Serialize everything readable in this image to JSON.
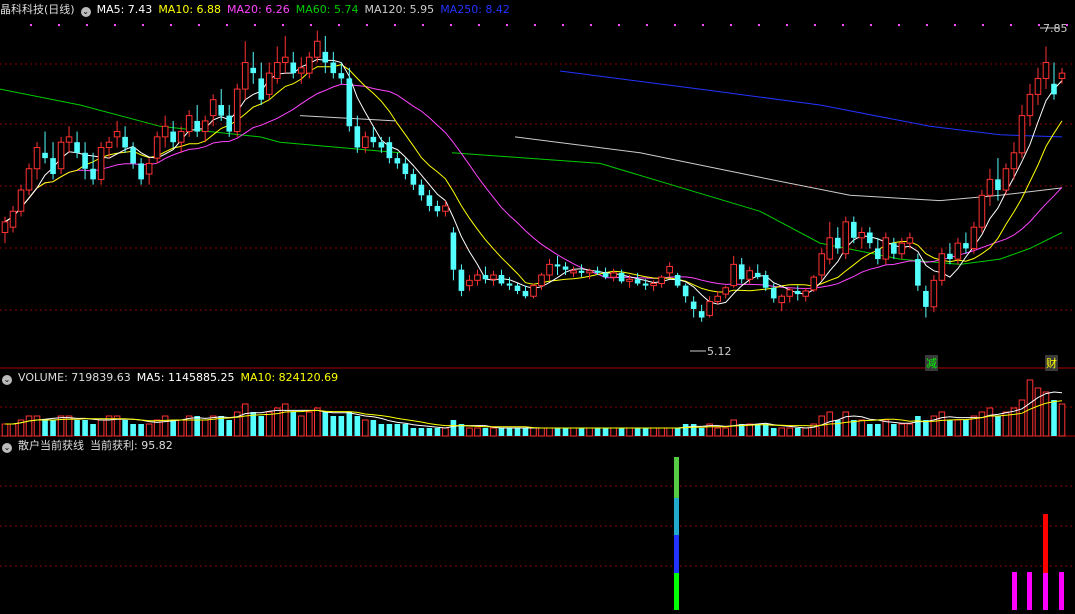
{
  "colors": {
    "up": "#ff3232",
    "down": "#54ffff",
    "ma5": "#ffffff",
    "ma10": "#ffff00",
    "ma20": "#ff44ff",
    "ma60": "#00cc00",
    "ma120": "#cccccc",
    "ma250": "#2233ff",
    "grid": "#8b0000",
    "divider": "#aa0000"
  },
  "header": {
    "stock": "晶科科技(日线)",
    "ma5": "MA5: 7.43",
    "ma10": "MA10: 6.88",
    "ma20": "MA20: 6.26",
    "ma60": "MA60: 5.74",
    "ma120": "MA120: 5.95",
    "ma250": "MA250: 8.42"
  },
  "volume_header": {
    "volume": "VOLUME: 719839.63",
    "ma5": "MA5: 1145885.25",
    "ma10": "MA10: 824120.69"
  },
  "indicator_header": {
    "name": "散户当前获线",
    "profit": "当前获利: 95.82"
  },
  "annotations": {
    "high": "7.85",
    "low": "5.12",
    "mark_jian": "减",
    "mark_cai": "财"
  },
  "chart_data": [
    {
      "type": "candlestick",
      "title": "晶科科技(日线)",
      "ylim": [
        4.9,
        8.1
      ],
      "ohlc": [
        [
          6.1,
          6.25,
          6.0,
          6.2
        ],
        [
          6.15,
          6.35,
          6.1,
          6.3
        ],
        [
          6.3,
          6.55,
          6.25,
          6.5
        ],
        [
          6.5,
          6.75,
          6.45,
          6.7
        ],
        [
          6.7,
          6.95,
          6.6,
          6.9
        ],
        [
          6.85,
          7.05,
          6.75,
          6.8
        ],
        [
          6.8,
          6.95,
          6.6,
          6.65
        ],
        [
          6.7,
          7.0,
          6.65,
          6.95
        ],
        [
          6.95,
          7.1,
          6.85,
          7.0
        ],
        [
          6.95,
          7.05,
          6.8,
          6.85
        ],
        [
          6.85,
          6.95,
          6.6,
          6.7
        ],
        [
          6.7,
          6.85,
          6.55,
          6.6
        ],
        [
          6.6,
          6.95,
          6.55,
          6.9
        ],
        [
          6.9,
          7.0,
          6.8,
          6.95
        ],
        [
          7.0,
          7.15,
          6.9,
          7.05
        ],
        [
          7.0,
          7.1,
          6.85,
          6.9
        ],
        [
          6.9,
          6.95,
          6.7,
          6.75
        ],
        [
          6.75,
          6.8,
          6.55,
          6.6
        ],
        [
          6.65,
          6.8,
          6.55,
          6.75
        ],
        [
          6.8,
          7.05,
          6.75,
          7.0
        ],
        [
          7.0,
          7.2,
          6.9,
          7.1
        ],
        [
          7.05,
          7.15,
          6.9,
          6.95
        ],
        [
          6.95,
          7.1,
          6.85,
          7.05
        ],
        [
          7.05,
          7.25,
          7.0,
          7.2
        ],
        [
          7.15,
          7.3,
          7.0,
          7.05
        ],
        [
          7.05,
          7.2,
          6.95,
          7.15
        ],
        [
          7.2,
          7.4,
          7.1,
          7.35
        ],
        [
          7.3,
          7.45,
          7.15,
          7.2
        ],
        [
          7.2,
          7.3,
          7.0,
          7.05
        ],
        [
          7.05,
          7.5,
          7.0,
          7.45
        ],
        [
          7.45,
          7.9,
          7.35,
          7.7
        ],
        [
          7.65,
          7.8,
          7.5,
          7.6
        ],
        [
          7.55,
          7.7,
          7.3,
          7.35
        ],
        [
          7.4,
          7.7,
          7.35,
          7.6
        ],
        [
          7.55,
          7.85,
          7.5,
          7.7
        ],
        [
          7.7,
          7.95,
          7.6,
          7.75
        ],
        [
          7.7,
          7.8,
          7.55,
          7.6
        ],
        [
          7.6,
          7.75,
          7.5,
          7.65
        ],
        [
          7.6,
          7.8,
          7.55,
          7.75
        ],
        [
          7.75,
          8.0,
          7.7,
          7.9
        ],
        [
          7.8,
          7.95,
          7.6,
          7.7
        ],
        [
          7.7,
          7.8,
          7.55,
          7.6
        ],
        [
          7.6,
          7.7,
          7.5,
          7.55
        ],
        [
          7.55,
          7.65,
          7.05,
          7.1
        ],
        [
          7.1,
          7.2,
          6.85,
          6.9
        ],
        [
          6.9,
          7.05,
          6.85,
          7.0
        ],
        [
          7.0,
          7.1,
          6.9,
          6.95
        ],
        [
          6.95,
          7.0,
          6.85,
          6.9
        ],
        [
          6.95,
          7.0,
          6.75,
          6.8
        ],
        [
          6.8,
          6.85,
          6.7,
          6.75
        ],
        [
          6.75,
          6.8,
          6.6,
          6.65
        ],
        [
          6.65,
          6.7,
          6.5,
          6.55
        ],
        [
          6.55,
          6.6,
          6.4,
          6.45
        ],
        [
          6.45,
          6.5,
          6.3,
          6.35
        ],
        [
          6.35,
          6.4,
          6.25,
          6.3
        ],
        [
          6.3,
          6.4,
          6.25,
          6.35
        ],
        [
          6.1,
          6.15,
          5.65,
          5.75
        ],
        [
          5.75,
          5.8,
          5.5,
          5.55
        ],
        [
          5.6,
          5.7,
          5.55,
          5.65
        ],
        [
          5.65,
          5.75,
          5.6,
          5.7
        ],
        [
          5.7,
          5.78,
          5.62,
          5.66
        ],
        [
          5.66,
          5.74,
          5.6,
          5.7
        ],
        [
          5.7,
          5.75,
          5.6,
          5.62
        ],
        [
          5.62,
          5.68,
          5.56,
          5.6
        ],
        [
          5.6,
          5.62,
          5.52,
          5.55
        ],
        [
          5.55,
          5.6,
          5.48,
          5.5
        ],
        [
          5.5,
          5.62,
          5.48,
          5.6
        ],
        [
          5.6,
          5.72,
          5.56,
          5.7
        ],
        [
          5.7,
          5.85,
          5.65,
          5.8
        ],
        [
          5.8,
          5.88,
          5.7,
          5.78
        ],
        [
          5.78,
          5.82,
          5.7,
          5.75
        ],
        [
          5.72,
          5.78,
          5.68,
          5.74
        ],
        [
          5.74,
          5.8,
          5.68,
          5.72
        ],
        [
          5.72,
          5.76,
          5.66,
          5.74
        ],
        [
          5.74,
          5.78,
          5.7,
          5.72
        ],
        [
          5.72,
          5.77,
          5.66,
          5.68
        ],
        [
          5.68,
          5.76,
          5.64,
          5.72
        ],
        [
          5.72,
          5.75,
          5.62,
          5.64
        ],
        [
          5.64,
          5.7,
          5.58,
          5.66
        ],
        [
          5.66,
          5.72,
          5.6,
          5.62
        ],
        [
          5.62,
          5.66,
          5.56,
          5.6
        ],
        [
          5.6,
          5.65,
          5.55,
          5.62
        ],
        [
          5.62,
          5.7,
          5.58,
          5.68
        ],
        [
          5.72,
          5.82,
          5.68,
          5.78
        ],
        [
          5.7,
          5.72,
          5.58,
          5.6
        ],
        [
          5.6,
          5.62,
          5.44,
          5.5
        ],
        [
          5.45,
          5.5,
          5.3,
          5.38
        ],
        [
          5.36,
          5.42,
          5.26,
          5.3
        ],
        [
          5.32,
          5.5,
          5.3,
          5.45
        ],
        [
          5.45,
          5.55,
          5.42,
          5.5
        ],
        [
          5.52,
          5.6,
          5.48,
          5.58
        ],
        [
          5.6,
          5.88,
          5.58,
          5.8
        ],
        [
          5.8,
          5.86,
          5.62,
          5.66
        ],
        [
          5.66,
          5.78,
          5.62,
          5.74
        ],
        [
          5.72,
          5.8,
          5.66,
          5.68
        ],
        [
          5.7,
          5.74,
          5.55,
          5.58
        ],
        [
          5.58,
          5.62,
          5.44,
          5.48
        ],
        [
          5.44,
          5.52,
          5.36,
          5.5
        ],
        [
          5.5,
          5.58,
          5.44,
          5.56
        ],
        [
          5.55,
          5.6,
          5.46,
          5.52
        ],
        [
          5.5,
          5.58,
          5.45,
          5.55
        ],
        [
          5.56,
          5.7,
          5.54,
          5.68
        ],
        [
          5.7,
          5.95,
          5.65,
          5.9
        ],
        [
          5.85,
          6.2,
          5.8,
          6.05
        ],
        [
          6.05,
          6.15,
          5.9,
          5.95
        ],
        [
          5.9,
          6.25,
          5.85,
          6.2
        ],
        [
          6.2,
          6.25,
          6.0,
          6.05
        ],
        [
          6.05,
          6.15,
          5.95,
          6.1
        ],
        [
          6.1,
          6.15,
          5.95,
          6.0
        ],
        [
          5.95,
          6.05,
          5.8,
          5.85
        ],
        [
          5.85,
          6.1,
          5.8,
          6.05
        ],
        [
          6.0,
          6.05,
          5.85,
          5.9
        ],
        [
          5.9,
          6.05,
          5.85,
          6.0
        ],
        [
          6.0,
          6.1,
          5.95,
          6.05
        ],
        [
          5.85,
          5.9,
          5.55,
          5.6
        ],
        [
          5.55,
          5.6,
          5.3,
          5.4
        ],
        [
          5.4,
          5.7,
          5.35,
          5.65
        ],
        [
          5.65,
          5.95,
          5.6,
          5.9
        ],
        [
          5.9,
          6.0,
          5.8,
          5.85
        ],
        [
          5.85,
          6.05,
          5.8,
          6.0
        ],
        [
          6.0,
          6.1,
          5.9,
          5.95
        ],
        [
          5.95,
          6.2,
          5.9,
          6.15
        ],
        [
          6.15,
          6.5,
          6.1,
          6.45
        ],
        [
          6.45,
          6.7,
          6.35,
          6.6
        ],
        [
          6.6,
          6.8,
          6.4,
          6.5
        ],
        [
          6.5,
          6.75,
          6.45,
          6.7
        ],
        [
          6.7,
          6.95,
          6.6,
          6.85
        ],
        [
          6.85,
          7.3,
          6.8,
          7.2
        ],
        [
          7.2,
          7.5,
          7.1,
          7.4
        ],
        [
          7.4,
          7.65,
          7.3,
          7.55
        ],
        [
          7.55,
          7.85,
          7.45,
          7.7
        ],
        [
          7.5,
          7.7,
          7.35,
          7.4
        ],
        [
          7.55,
          7.65,
          7.5,
          7.6
        ]
      ],
      "ma_series": [
        {
          "name": "MA60",
          "values": [
            [
              0,
              7.45
            ],
            [
              80,
              7.3
            ],
            [
              160,
              7.1
            ],
            [
              260,
              7.0
            ],
            [
              280,
              6.95
            ],
            [
              400,
              6.85
            ]
          ]
        },
        {
          "name": "MA120",
          "values": [
            [
              300,
              7.2
            ],
            [
              395,
              7.15
            ]
          ]
        },
        {
          "name": "MA60",
          "values": [
            [
              452,
              6.85
            ],
            [
              600,
              6.75
            ],
            [
              760,
              6.3
            ],
            [
              820,
              6.0
            ],
            [
              900,
              5.85
            ],
            [
              960,
              5.8
            ],
            [
              1000,
              5.85
            ],
            [
              1030,
              5.95
            ],
            [
              1062,
              6.1
            ]
          ]
        },
        {
          "name": "MA120",
          "values": [
            [
              515,
              7.0
            ],
            [
              640,
              6.85
            ],
            [
              760,
              6.62
            ],
            [
              850,
              6.45
            ],
            [
              940,
              6.4
            ],
            [
              1000,
              6.45
            ],
            [
              1062,
              6.52
            ]
          ]
        },
        {
          "name": "MA250",
          "values": [
            [
              560,
              7.62
            ],
            [
              700,
              7.45
            ],
            [
              820,
              7.3
            ],
            [
              930,
              7.1
            ],
            [
              1000,
              7.02
            ],
            [
              1062,
              7.0
            ]
          ]
        }
      ]
    },
    {
      "type": "bar",
      "title": "VOLUME",
      "note": "volume bars (relative values)",
      "values": [
        3,
        3,
        4,
        5,
        5,
        4,
        4,
        5,
        5,
        4,
        4,
        3,
        4,
        5,
        5,
        4,
        3,
        3,
        3,
        4,
        5,
        4,
        4,
        5,
        5,
        4,
        5,
        5,
        4,
        6,
        8,
        6,
        5,
        6,
        7,
        8,
        6,
        5,
        6,
        7,
        6,
        5,
        5,
        6,
        5,
        4,
        4,
        3,
        3,
        3,
        3,
        2,
        2,
        2,
        2,
        2,
        4,
        3,
        2,
        2,
        2,
        2,
        2,
        2,
        2,
        2,
        2,
        2,
        2,
        2,
        2,
        2,
        2,
        2,
        2,
        2,
        2,
        2,
        2,
        2,
        2,
        2,
        2,
        2,
        2,
        3,
        3,
        2,
        3,
        2,
        2,
        4,
        3,
        3,
        3,
        3,
        2,
        2,
        2,
        2,
        2,
        3,
        5,
        6,
        4,
        6,
        4,
        4,
        3,
        3,
        4,
        3,
        3,
        3,
        5,
        4,
        5,
        6,
        4,
        4,
        4,
        5,
        6,
        7,
        5,
        6,
        7,
        9,
        14,
        12,
        11,
        9,
        8
      ]
    },
    {
      "type": "bar",
      "title": "散户当前获线",
      "series": [
        {
          "name": "当前获利",
          "values": [
            95.82
          ]
        }
      ]
    }
  ]
}
